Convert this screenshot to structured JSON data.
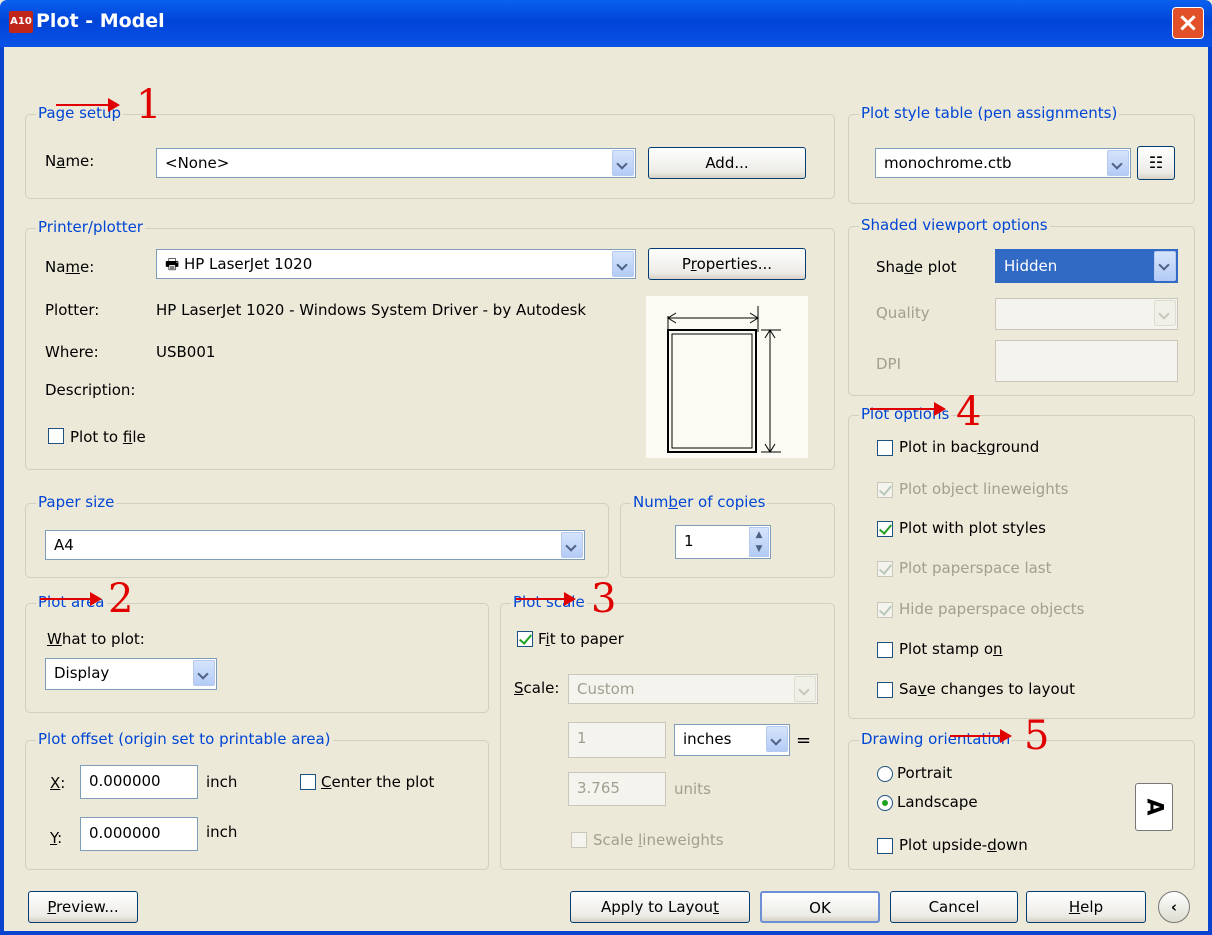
{
  "window": {
    "title": "Plot - Model",
    "icon_text": "A10",
    "close_icon": "close-icon"
  },
  "page_setup": {
    "legend": "Page setup",
    "name_label": "Name:",
    "name_value": "<None>",
    "add_button": "Add..."
  },
  "printer": {
    "legend": "Printer/plotter",
    "name_label": "Name:",
    "name_value": "HP LaserJet 1020",
    "properties_button": "Properties...",
    "plotter_label": "Plotter:",
    "plotter_value": "HP LaserJet 1020 - Windows System Driver - by Autodesk",
    "where_label": "Where:",
    "where_value": "USB001",
    "description_label": "Description:",
    "plot_to_file": "Plot to file"
  },
  "paper_size": {
    "legend": "Paper size",
    "value": "A4"
  },
  "copies": {
    "legend": "Number of copies",
    "value": "1"
  },
  "plot_area": {
    "legend": "Plot area",
    "what_label": "What to plot:",
    "what_value": "Display"
  },
  "plot_offset": {
    "legend": "Plot offset (origin set to printable area)",
    "x_label": "X:",
    "x_value": "0.000000",
    "x_unit": "inch",
    "y_label": "Y:",
    "y_value": "0.000000",
    "y_unit": "inch",
    "center": "Center the plot"
  },
  "plot_scale": {
    "legend": "Plot scale",
    "fit": "Fit to paper",
    "scale_label": "Scale:",
    "scale_value": "Custom",
    "value1": "1",
    "unit1": "inches",
    "equals": "=",
    "value2": "3.765",
    "unit2": "units",
    "lineweights": "Scale lineweights"
  },
  "pen": {
    "legend": "Plot style table (pen assignments)",
    "value": "monochrome.ctb"
  },
  "shaded": {
    "legend": "Shaded viewport options",
    "shade_label": "Shade plot",
    "shade_value": "Hidden",
    "quality_label": "Quality",
    "dpi_label": "DPI"
  },
  "options": {
    "legend": "Plot options",
    "items": [
      "Plot in background",
      "Plot object lineweights",
      "Plot with plot styles",
      "Plot paperspace last",
      "Hide paperspace objects",
      "Plot stamp on",
      "Save changes to layout"
    ]
  },
  "orientation": {
    "legend": "Drawing orientation",
    "portrait": "Portrait",
    "landscape": "Landscape",
    "upside": "Plot upside-down",
    "preview_letter": "A"
  },
  "buttons": {
    "preview": "Preview...",
    "apply": "Apply to Layout",
    "ok": "OK",
    "cancel": "Cancel",
    "help": "Help"
  },
  "annotations": [
    "1",
    "2",
    "3",
    "4",
    "5"
  ]
}
